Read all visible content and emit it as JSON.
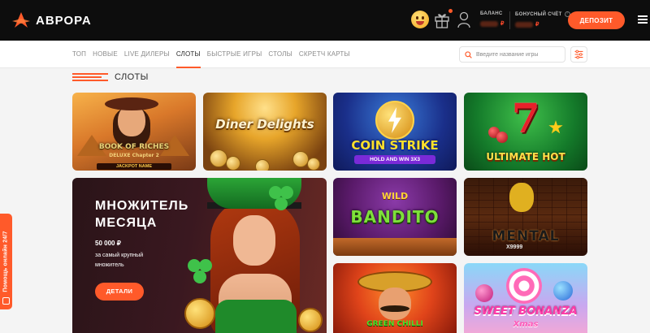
{
  "header": {
    "logo_text": "АВРОРА",
    "balance_label": "БАЛАНС",
    "balance_currency": "₽",
    "bonus_label": "БОНУСНЫЙ СЧЁТ",
    "bonus_currency": "₽",
    "info_icon": "?",
    "deposit_label": "ДЕПОЗИТ",
    "icons": [
      "emoji-face-icon",
      "gift-icon",
      "user-icon",
      "info-icon",
      "menu-icon"
    ]
  },
  "nav": {
    "tabs": [
      {
        "label": "ТОП",
        "active": false
      },
      {
        "label": "НОВЫЕ",
        "active": false
      },
      {
        "label": "LIVE ДИЛЕРЫ",
        "active": false
      },
      {
        "label": "СЛОТЫ",
        "active": true
      },
      {
        "label": "БЫСТРЫЕ ИГРЫ",
        "active": false
      },
      {
        "label": "СТОЛЫ",
        "active": false
      },
      {
        "label": "СКРЕТЧ КАРТЫ",
        "active": false
      }
    ],
    "search_placeholder": "Введите название игры",
    "icons": [
      "search-icon",
      "filter-icon"
    ]
  },
  "section": {
    "title": "СЛОТЫ"
  },
  "games": {
    "g1": {
      "title": "BOOK OF RICHES",
      "sub": "DELUXE Chapter 2",
      "extra": "JACKPOT NAME"
    },
    "g2": {
      "title": "Diner Delights"
    },
    "g3": {
      "title": "COIN STRIKE",
      "sub": "HOLD AND WIN 3X3"
    },
    "g4": {
      "title": "ULTIMATE HOT"
    },
    "g5": {
      "title": "BANDITO",
      "sub": "WILD"
    },
    "g6": {
      "title": "MENTAL",
      "sub": "X9999"
    },
    "g7": {
      "title": "GREEN CHILLI"
    },
    "g8": {
      "title": "SWEET BONANZA",
      "sub": "Xmas"
    }
  },
  "promo": {
    "title": "МНОЖИТЕЛЬ МЕСЯЦА",
    "amount": "50 000 ₽",
    "description": "за самый крупный множитель",
    "button_label": "ДЕТАЛИ"
  },
  "help": {
    "label": "Помощь онлайн 24/7"
  },
  "colors": {
    "accent": "#ff5a2a",
    "header_bg": "#0d0d0d",
    "page_bg": "#f4f4f4"
  }
}
